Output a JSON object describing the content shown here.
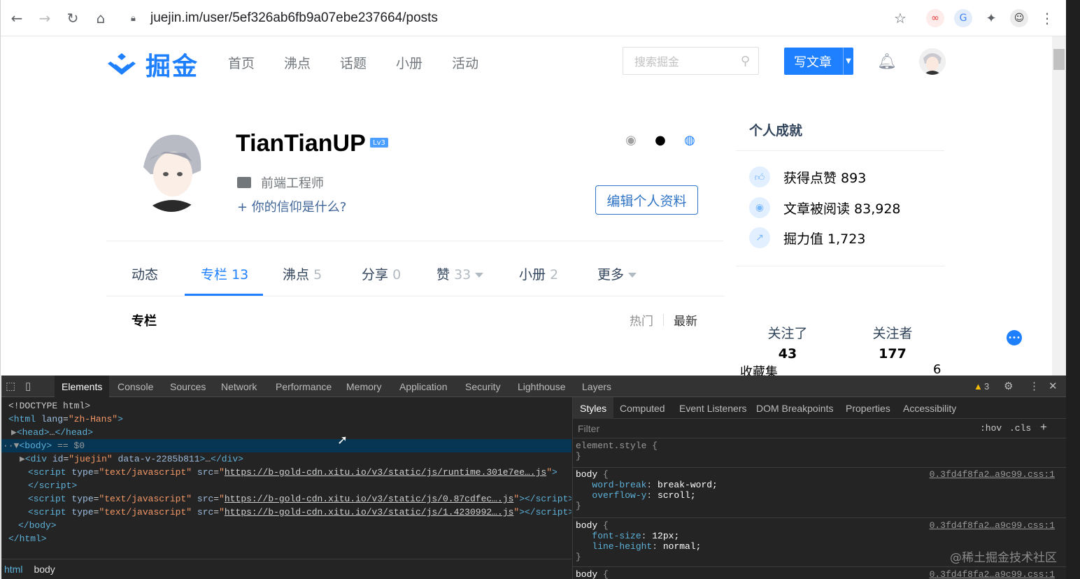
{
  "browser": {
    "url": "juejin.im/user/5ef326ab6fb9a07ebe237664/posts"
  },
  "header": {
    "logo_text": "掘金",
    "nav": [
      "首页",
      "沸点",
      "话题",
      "小册",
      "活动"
    ],
    "search_placeholder": "搜索掘金",
    "write_label": "写文章"
  },
  "profile": {
    "username": "TianTianUP",
    "level": "Lv3",
    "job": "前端工程师",
    "motto": "+ 你的信仰是什么?",
    "edit_label": "编辑个人资料"
  },
  "tabs": [
    {
      "label": "动态",
      "count": ""
    },
    {
      "label": "专栏",
      "count": "13"
    },
    {
      "label": "沸点",
      "count": "5"
    },
    {
      "label": "分享",
      "count": "0"
    },
    {
      "label": "赞",
      "count": "33"
    },
    {
      "label": "小册",
      "count": "2"
    },
    {
      "label": "更多",
      "count": ""
    }
  ],
  "section": {
    "title": "专栏",
    "sort_hot": "热门",
    "sort_new": "最新"
  },
  "sidebar": {
    "title": "个人成就",
    "achievements": [
      {
        "label": "获得点赞 893"
      },
      {
        "label": "文章被阅读 83,928"
      },
      {
        "label": "掘力值 1,723"
      }
    ],
    "following_label": "关注了",
    "following_count": "43",
    "followers_label": "关注者",
    "followers_count": "177",
    "collections_label": "收藏集",
    "collections_count": "6"
  },
  "devtools": {
    "tabs": [
      "Elements",
      "Console",
      "Sources",
      "Network",
      "Performance",
      "Memory",
      "Application",
      "Security",
      "Lighthouse",
      "Layers"
    ],
    "warnings": "3",
    "style_tabs": [
      "Styles",
      "Computed",
      "Event Listeners",
      "DOM Breakpoints",
      "Properties",
      "Accessibility"
    ],
    "filter_placeholder": "Filter",
    "hov": ":hov",
    "cls": ".cls",
    "breadcrumb": [
      "html",
      "body"
    ],
    "src1": "0.3fd4f8fa2…a9c99.css:1",
    "src2": "0.3fd4f8fa2…a9c99.css:1",
    "src3": "0.3fd4f8fa2…a9c99.css:1"
  },
  "watermark": "@稀土掘金技术社区"
}
